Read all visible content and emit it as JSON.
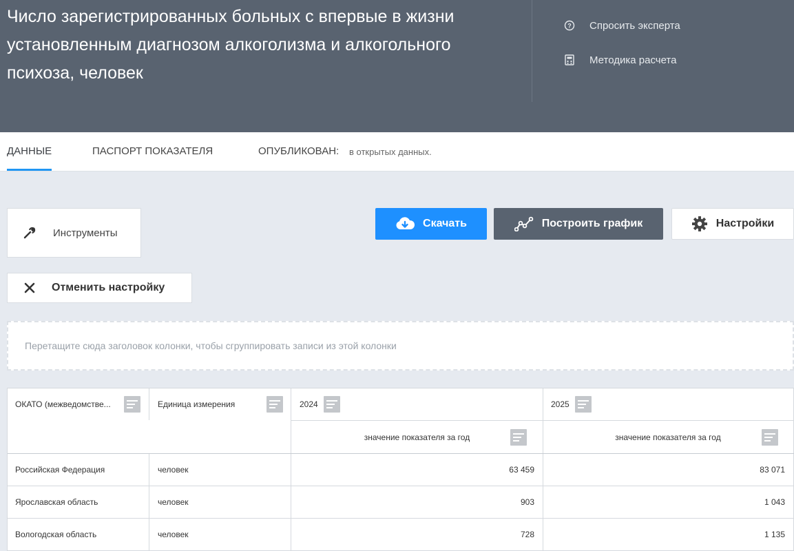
{
  "header": {
    "title": "Число зарегистрированных больных с впервые в жизни установленным диагнозом алкоголизма и алкогольного психоза, человек",
    "links": [
      {
        "label": "Спросить эксперта",
        "icon": "question-circle-icon"
      },
      {
        "label": "Методика расчета",
        "icon": "calculator-icon"
      }
    ]
  },
  "tabs": [
    {
      "label": "ДАННЫЕ",
      "active": true
    },
    {
      "label": "ПАСПОРТ ПОКАЗАТЕЛЯ",
      "active": false
    }
  ],
  "published": {
    "label": "ОПУБЛИКОВАН:",
    "value": "в открытых данных."
  },
  "toolbar": {
    "tools_label": "Инструменты",
    "download_label": "Скачать",
    "chart_label": "Построить график",
    "settings_label": "Настройки",
    "reset_label": "Отменить настройку"
  },
  "group_panel": {
    "placeholder": "Перетащите сюда заголовок колонки, чтобы сгруппировать записи из этой колонки"
  },
  "table": {
    "columns": [
      "ОКАТО (межведомстве...",
      "Единица измерения",
      "2024",
      "2025"
    ],
    "subheaders": [
      "значение показателя за год",
      "значение показателя за год"
    ],
    "rows": [
      {
        "region": "Российская Федерация",
        "unit": "человек",
        "v2024": "63 459",
        "v2025": "83 071"
      },
      {
        "region": "Ярославская область",
        "unit": "человек",
        "v2024": "903",
        "v2025": "1 043"
      },
      {
        "region": "Вологодская область",
        "unit": "человек",
        "v2024": "728",
        "v2025": "1 135"
      }
    ]
  },
  "colors": {
    "header_bg": "#596370",
    "accent": "#1e90ff",
    "page_bg": "#e6eaf0"
  }
}
